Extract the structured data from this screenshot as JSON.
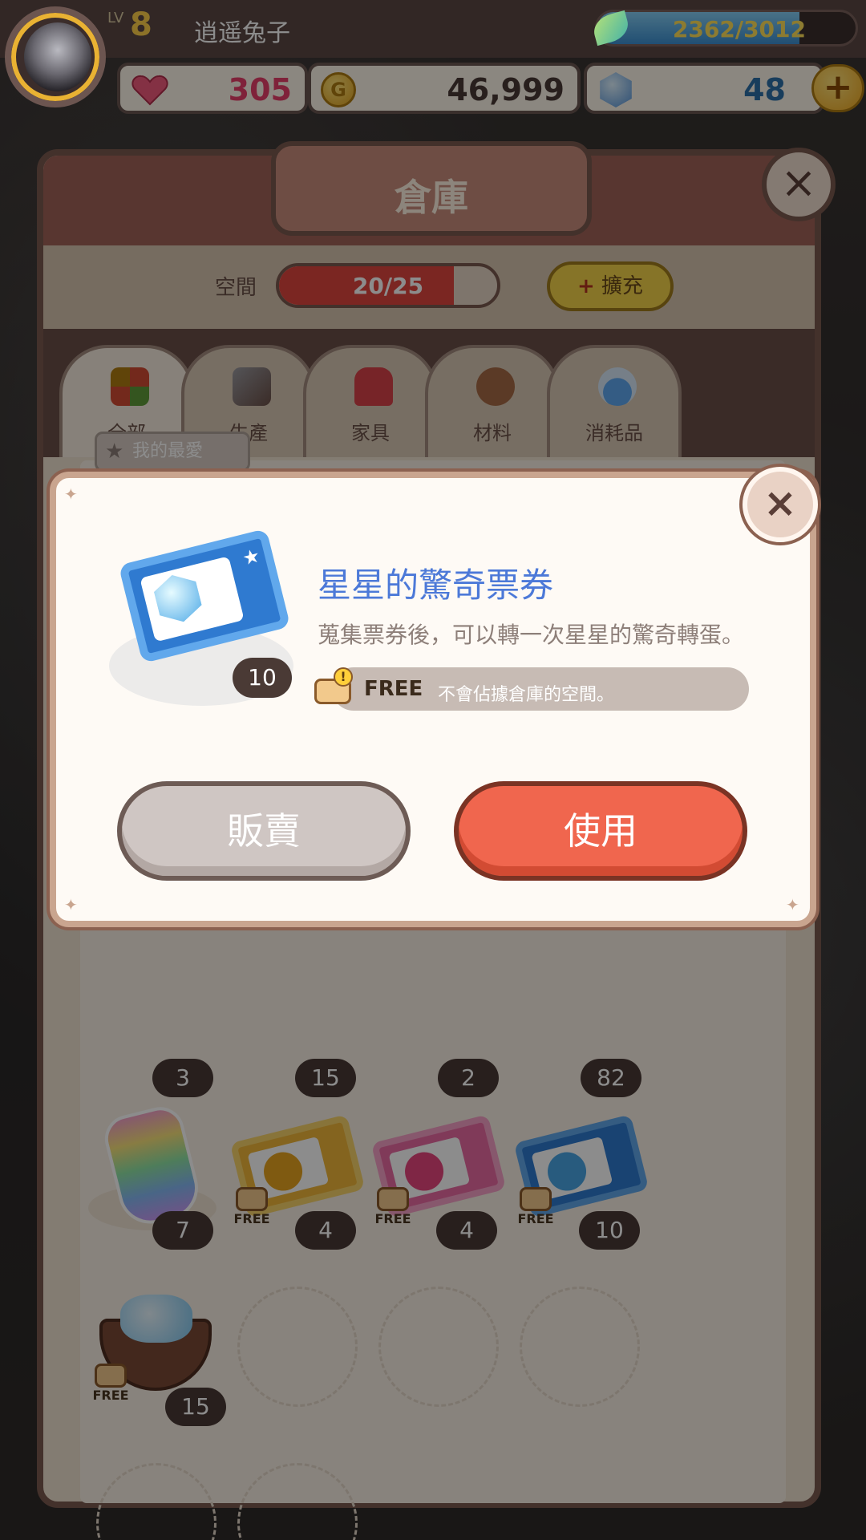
{
  "player": {
    "level_tag": "LV",
    "level": "8",
    "name": "逍遥兔子",
    "exp_text": "2362/3012",
    "exp_fraction": 0.784
  },
  "resources": {
    "hearts": "305",
    "gold": "46,999",
    "gems": "48",
    "coin_glyph": "G",
    "plus_glyph": "+"
  },
  "warehouse": {
    "title": "倉庫",
    "close_glyph": "×",
    "space_label": "空間",
    "space_text": "20/25",
    "space_fraction": 0.8,
    "expand_label": "擴充",
    "tabs": [
      {
        "label": "全部",
        "icon": "grid-icon"
      },
      {
        "label": "生產",
        "icon": "hammer-icon"
      },
      {
        "label": "家具",
        "icon": "sofa-icon"
      },
      {
        "label": "材料",
        "icon": "log-icon"
      },
      {
        "label": "消耗品",
        "icon": "potion-icon"
      }
    ],
    "favorites_label": "我的最愛",
    "row_counts": [
      "3",
      "15",
      "2",
      "82"
    ],
    "items": [
      {
        "icon": "rainbow-bag-icon",
        "count": "7",
        "free": false
      },
      {
        "icon": "gold-ticket-icon",
        "count": "4",
        "free": true
      },
      {
        "icon": "heart-ticket-icon",
        "count": "4",
        "free": true
      },
      {
        "icon": "star-ticket-icon",
        "count": "10",
        "free": true
      },
      {
        "icon": "crystal-bowl-icon",
        "count": "15",
        "free": true
      }
    ],
    "free_label": "FREE"
  },
  "modal": {
    "close_glyph": "×",
    "item_title": "星星的驚奇票券",
    "item_desc": "蒐集票券後，可以轉一次星星的驚奇轉蛋。",
    "item_count": "10",
    "free_label": "FREE",
    "free_note": "不會佔據倉庫的空間。",
    "sell_label": "販賣",
    "use_label": "使用"
  },
  "colors": {
    "accent_blue": "#4c79d8",
    "use_button": "#f0664e",
    "sell_button": "#cfc6c3",
    "space_fill": "#e0463f"
  }
}
